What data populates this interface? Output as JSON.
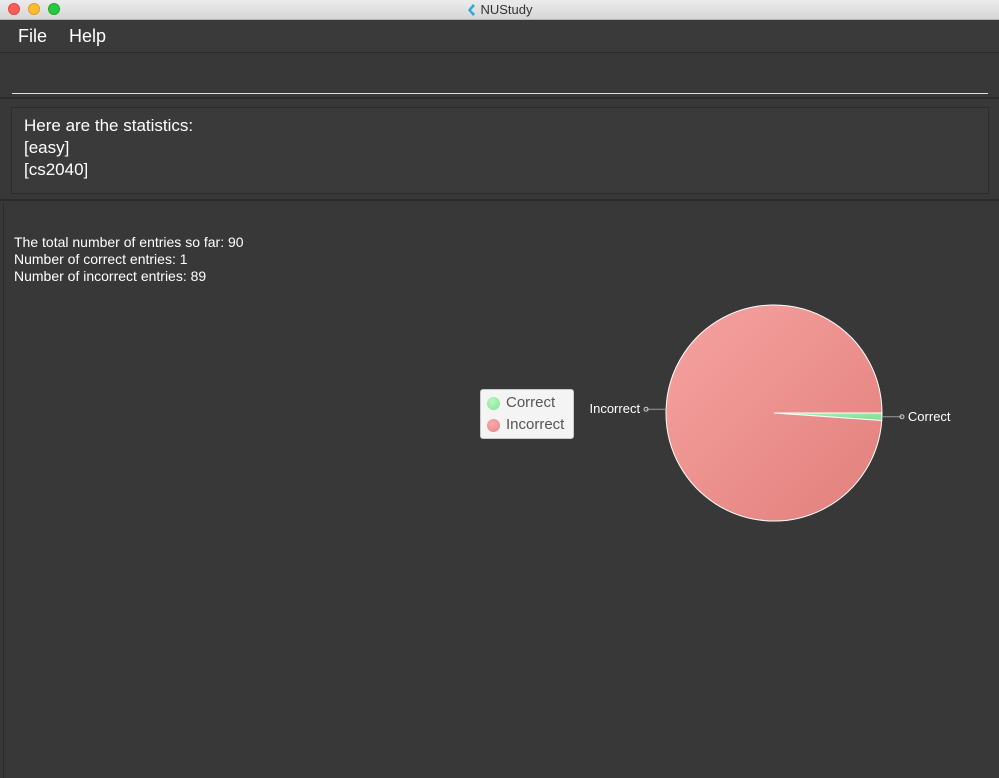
{
  "window": {
    "title": "NUStudy"
  },
  "menu": {
    "file": "File",
    "help": "Help"
  },
  "command": {
    "value": "",
    "placeholder": ""
  },
  "result": {
    "lines": [
      "Here are the statistics:",
      "[easy]",
      "[cs2040]"
    ]
  },
  "stats": {
    "total": "The total number of entries so far: 90",
    "correct": "Number of correct entries: 1",
    "incorrect": "Number of incorrect entries: 89"
  },
  "chart_data": {
    "type": "pie",
    "slices": [
      {
        "label": "Correct",
        "value": 1,
        "color": "#8ee69c"
      },
      {
        "label": "Incorrect",
        "value": 89,
        "color": "#ee8f8f"
      }
    ],
    "legend": [
      "Correct",
      "Incorrect"
    ],
    "legend_position": "left"
  }
}
